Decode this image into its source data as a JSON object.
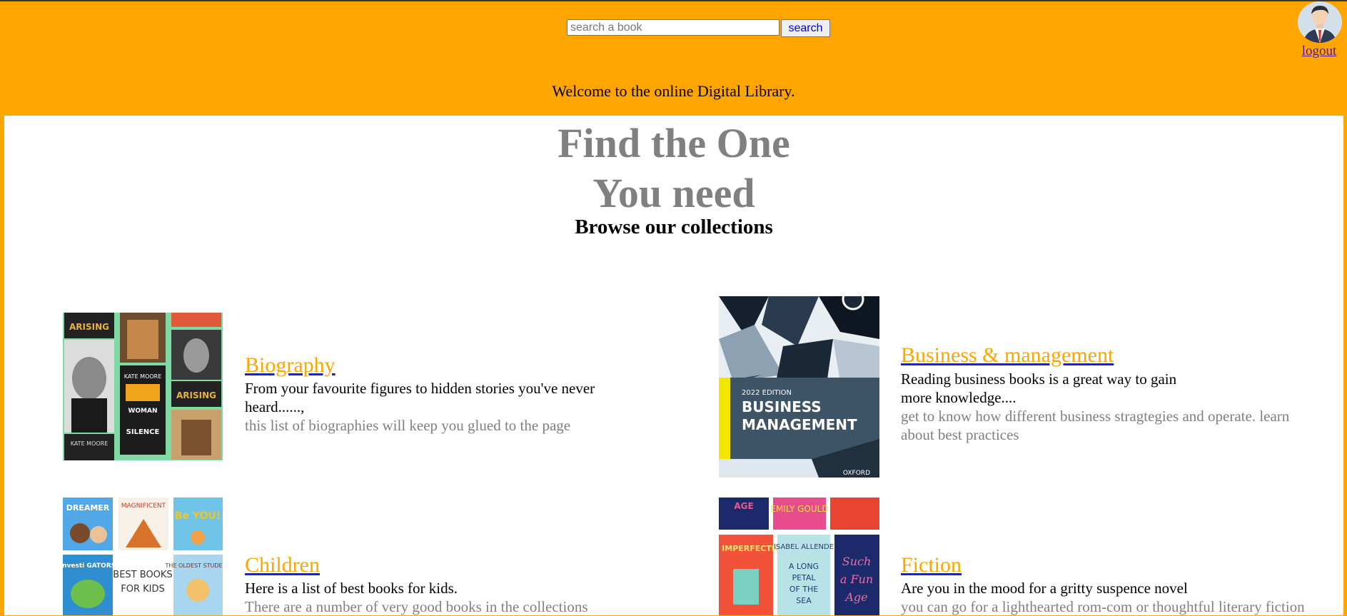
{
  "header": {
    "search": {
      "placeholder": "search a book",
      "value": ""
    },
    "search_button_label": "search",
    "logout_label": "logout",
    "welcome_text": "Welcome to the online Digital Library."
  },
  "hero": {
    "title_line1": "Find the One",
    "title_line2": "You need",
    "subtitle": "Browse our collections"
  },
  "collections": [
    {
      "title": "Biography",
      "description": "From your favourite figures to hidden stories you've never heard......,",
      "subtext": "this list of biographies will keep you glued to the page",
      "cover_text": [
        "ARISING",
        "KATE MOORE",
        "THE WOMAN THEY COULD NOT SILENCE",
        "ARISING",
        "KATE MOORE"
      ]
    },
    {
      "title": "Business & management",
      "description": "Reading business books is a great way to gain more knowledge....",
      "subtext": "get to know how different business stragtegies and operate. learn about best practices",
      "cover_text": [
        "2022 EDITION",
        "BUSINESS",
        "MANAGEMENT",
        "OXFORD"
      ]
    },
    {
      "title": "Children",
      "description": "Here is a list of best books for kids.",
      "subtext": "There are a number of very good books in the collections",
      "cover_text": [
        "DREAMER",
        "MAGNIFICENT",
        "Be YOU!",
        "Investi GATORS",
        "BEST BOOKS FOR KIDS",
        "THE OLDEST STUDENT"
      ]
    },
    {
      "title": "Fiction",
      "description": "Are you in the mood for a gritty suspence novel",
      "subtext": "you can go for a lighthearted rom-com or thoughtful literary fiction",
      "cover_text": [
        "AGE",
        "EMILY GOULD",
        "TINY IMPERFECTIONS",
        "ISABEL ALLENDE",
        "A LONG PETAL OF THE SEA",
        "Such a Fun Age"
      ]
    }
  ],
  "colors": {
    "header_bg": "#ffa500",
    "link": "#ffa500",
    "title_gray": "#808080"
  }
}
